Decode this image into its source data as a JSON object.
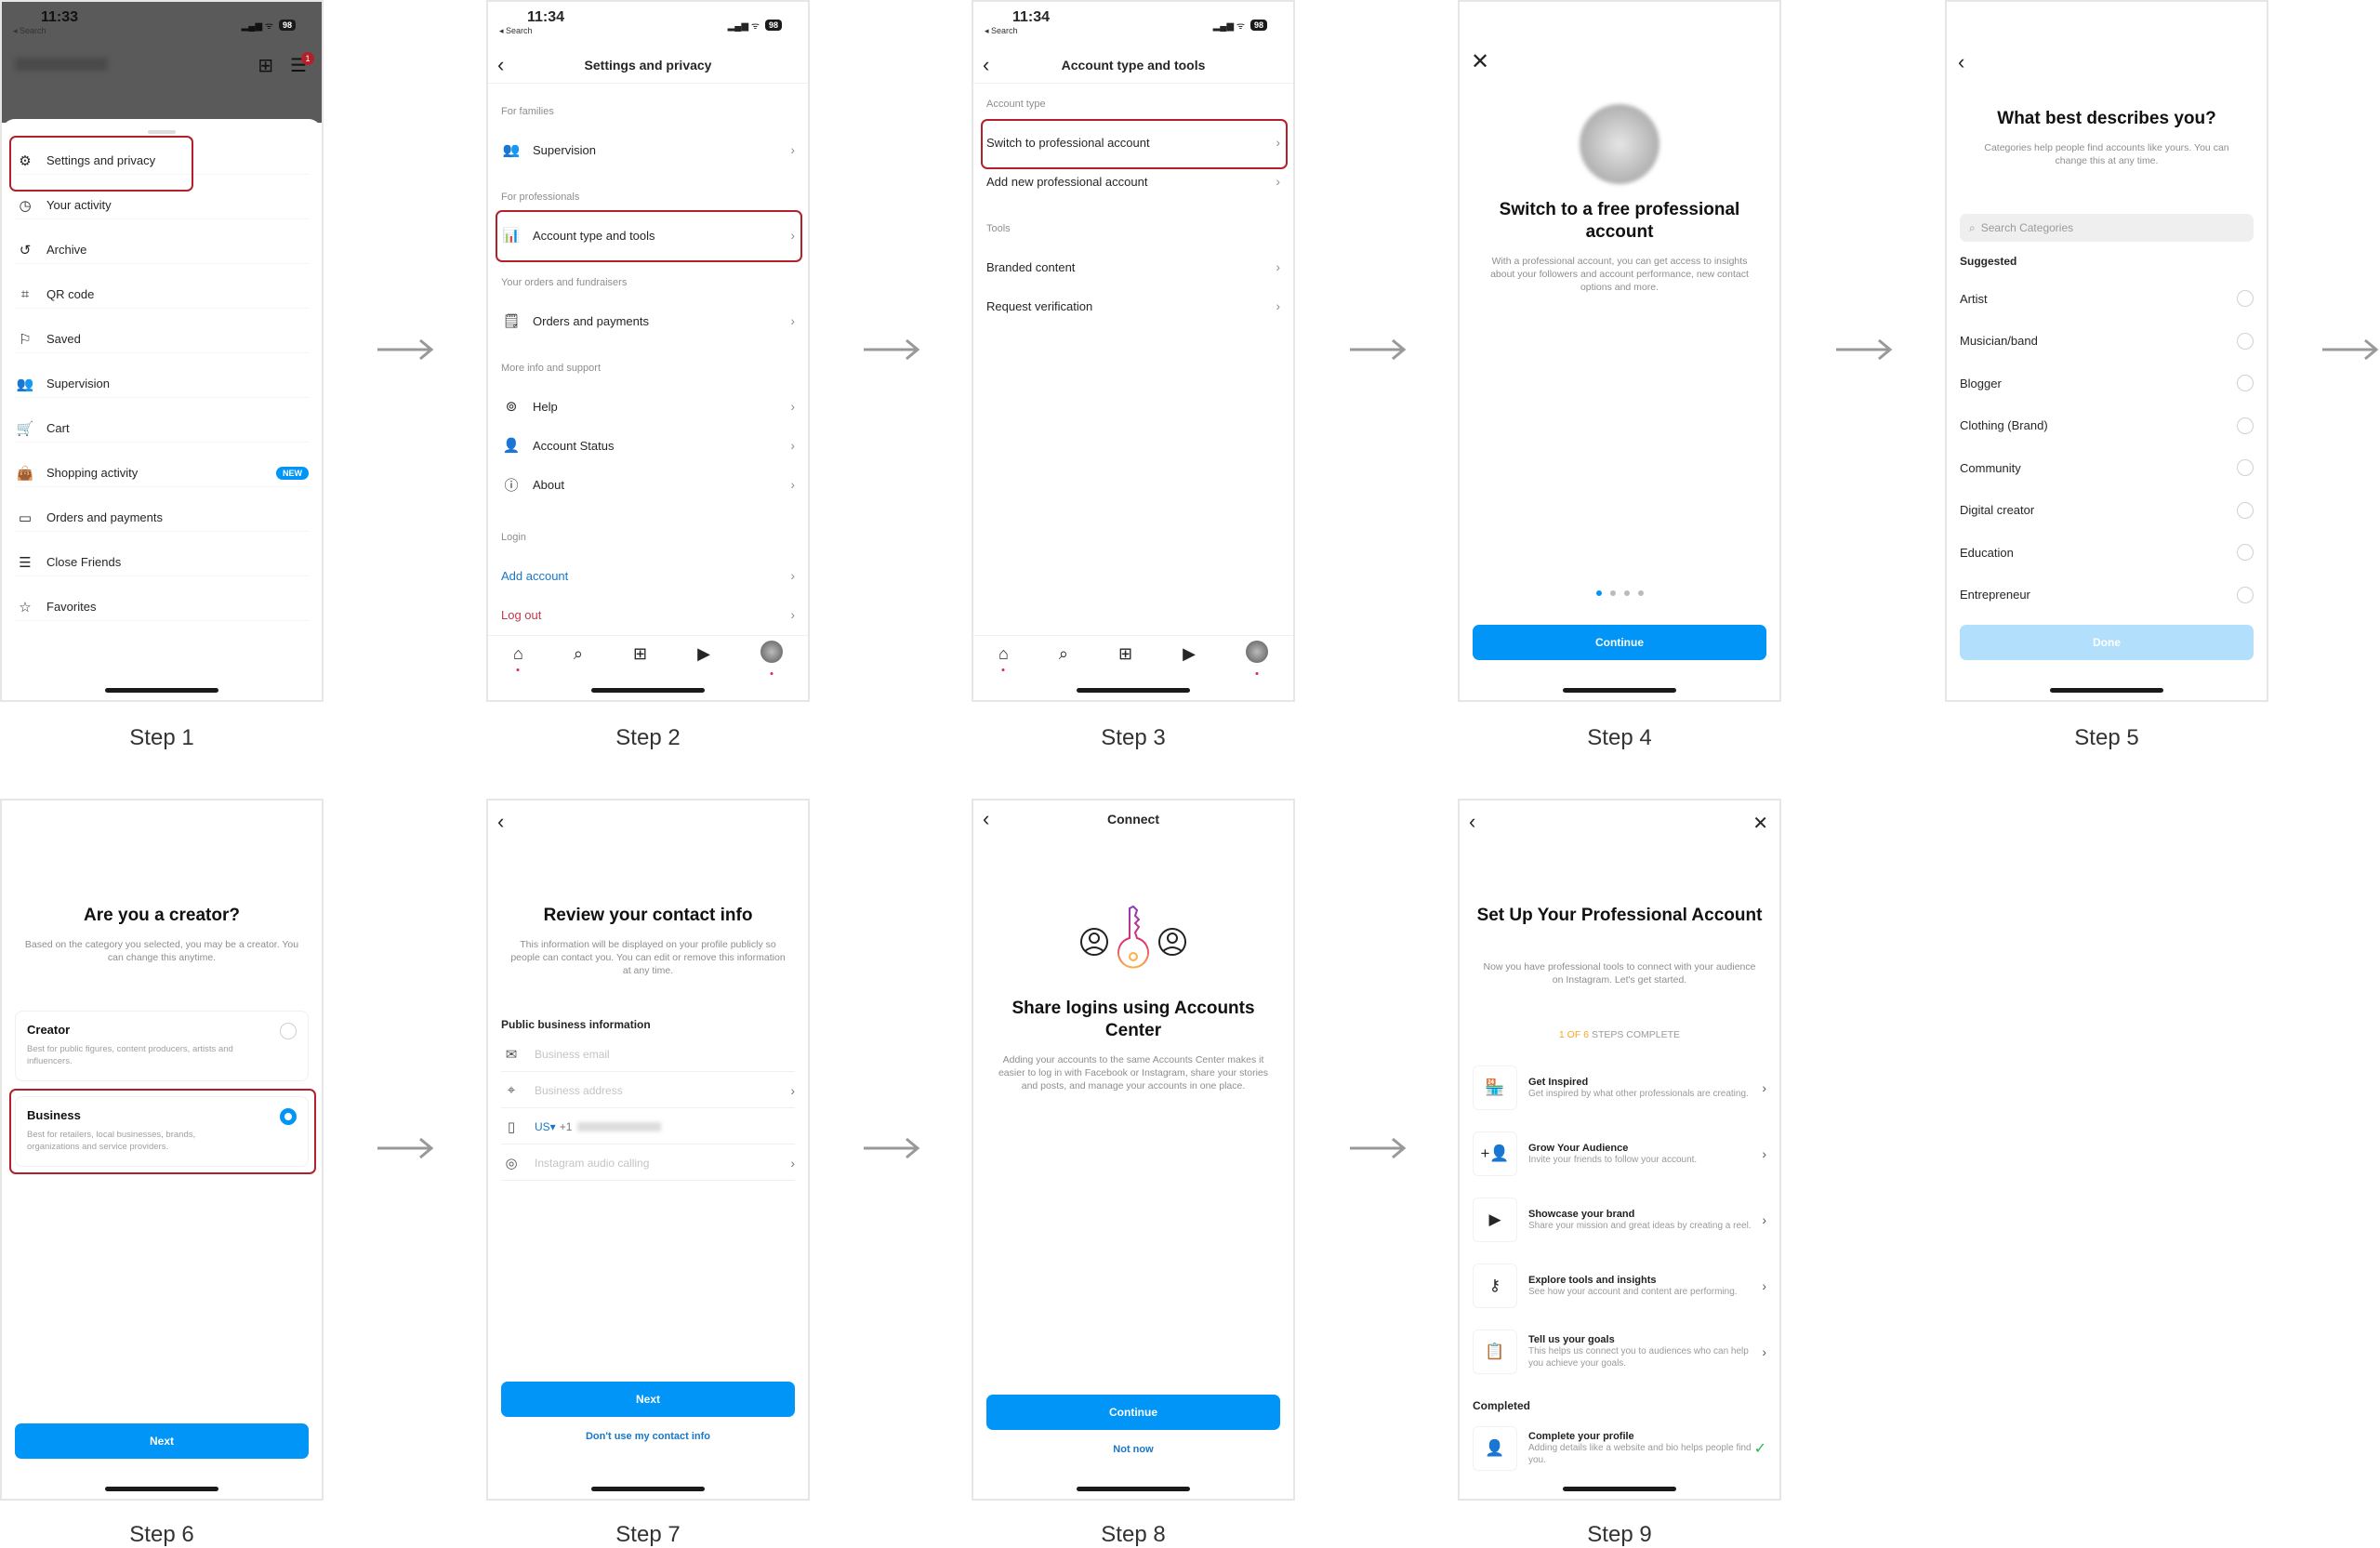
{
  "steps": [
    {
      "label": "Step 1"
    },
    {
      "label": "Step 2"
    },
    {
      "label": "Step 3"
    },
    {
      "label": "Step 4"
    },
    {
      "label": "Step 5"
    },
    {
      "label": "Step 6"
    },
    {
      "label": "Step 7"
    },
    {
      "label": "Step 8"
    },
    {
      "label": "Step 9"
    }
  ],
  "status": {
    "time_1": "11:33",
    "time_2": "11:34",
    "back": "◂ Search",
    "battery": "98"
  },
  "step1": {
    "notification_count": "1",
    "menu": [
      {
        "icon": "gear-icon",
        "glyph": "⚙",
        "label": "Settings and privacy"
      },
      {
        "icon": "activity-icon",
        "glyph": "◷",
        "label": "Your activity"
      },
      {
        "icon": "archive-icon",
        "glyph": "↺",
        "label": "Archive"
      },
      {
        "icon": "qr-code-icon",
        "glyph": "⌗",
        "label": "QR code"
      },
      {
        "icon": "bookmark-icon",
        "glyph": "⚐",
        "label": "Saved"
      },
      {
        "icon": "supervision-icon",
        "glyph": "👥",
        "label": "Supervision"
      },
      {
        "icon": "cart-icon",
        "glyph": "🛒",
        "label": "Cart"
      },
      {
        "icon": "shopping-bag-icon",
        "glyph": "👜",
        "label": "Shopping activity",
        "badge": "NEW"
      },
      {
        "icon": "card-icon",
        "glyph": "▭",
        "label": "Orders and payments"
      },
      {
        "icon": "list-icon",
        "glyph": "☰",
        "label": "Close Friends"
      },
      {
        "icon": "star-icon",
        "glyph": "☆",
        "label": "Favorites"
      }
    ]
  },
  "step2": {
    "title": "Settings and privacy",
    "sec_families": "For families",
    "supervision": "Supervision",
    "sec_professionals": "For professionals",
    "account_type_tools": "Account type and tools",
    "sec_orders": "Your orders and fundraisers",
    "orders_payments": "Orders and payments",
    "sec_more": "More info and support",
    "help": "Help",
    "account_status": "Account Status",
    "about": "About",
    "sec_login": "Login",
    "add_account": "Add account",
    "log_out": "Log out"
  },
  "step3": {
    "title": "Account type and tools",
    "sec_account_type": "Account type",
    "switch_pro": "Switch to professional account",
    "add_pro": "Add new professional account",
    "sec_tools": "Tools",
    "branded": "Branded content",
    "verification": "Request verification"
  },
  "step4": {
    "title": "Switch to a free professional account",
    "description": "With a professional account, you can get access to insights about your followers and account performance, new contact options and more.",
    "page_index": "1 of 4",
    "continue": "Continue"
  },
  "step5": {
    "title": "What best describes you?",
    "description": "Categories help people find accounts like yours. You can change this at any time.",
    "search_placeholder": "Search Categories",
    "suggested": "Suggested",
    "categories": [
      "Artist",
      "Musician/band",
      "Blogger",
      "Clothing (Brand)",
      "Community",
      "Digital creator",
      "Education",
      "Entrepreneur"
    ],
    "done": "Done"
  },
  "step6": {
    "title": "Are you a creator?",
    "description": "Based on the category you selected, you may be a creator. You can change this anytime.",
    "creator_title": "Creator",
    "creator_desc": "Best for public figures, content producers, artists and influencers.",
    "business_title": "Business",
    "business_desc": "Best for retailers, local businesses, brands, organizations and service providers.",
    "selected": "Business",
    "next": "Next"
  },
  "step7": {
    "title": "Review your contact info",
    "description": "This information will be displayed on your profile publicly so people can contact you. You can edit or remove this information at any time.",
    "section": "Public business information",
    "email_placeholder": "Business email",
    "address_placeholder": "Business address",
    "country": "US▾",
    "country_code": "+1",
    "audio_placeholder": "Instagram audio calling",
    "next": "Next",
    "skip": "Don't use my contact info"
  },
  "step8": {
    "header": "Connect",
    "title": "Share logins using Accounts Center",
    "description": "Adding your accounts to the same Accounts Center makes it easier to log in with Facebook or Instagram, share your stories and posts, and manage your accounts in one place.",
    "continue": "Continue",
    "not_now": "Not now"
  },
  "step9": {
    "title": "Set Up Your Professional Account",
    "description": "Now you have professional tools to connect with your audience on Instagram. Let's get started.",
    "progress_count": "1 OF 6",
    "progress_text": " STEPS COMPLETE",
    "progress_color": "#f5a623",
    "tasks": [
      {
        "icon": "store-icon",
        "glyph": "🏪",
        "title": "Get Inspired",
        "desc": "Get inspired by what other professionals are creating."
      },
      {
        "icon": "add-person-icon",
        "glyph": "+👤",
        "title": "Grow Your Audience",
        "desc": "Invite your friends to follow your account."
      },
      {
        "icon": "reel-icon",
        "glyph": "▶",
        "title": "Showcase your brand",
        "desc": "Share your mission and great ideas by creating a reel."
      },
      {
        "icon": "key-icon",
        "glyph": "⚷",
        "title": "Explore tools and insights",
        "desc": "See how your account and content are performing."
      },
      {
        "icon": "clipboard-icon",
        "glyph": "📋",
        "title": "Tell us your goals",
        "desc": "This helps us connect you to audiences who can help you achieve your goals."
      }
    ],
    "completed_label": "Completed",
    "completed": {
      "icon": "person-icon",
      "glyph": "👤",
      "title": "Complete your profile",
      "desc": "Adding details like a website and bio helps people find you."
    }
  },
  "colors": {
    "accent": "#0095f6",
    "highlight": "#b3202a",
    "link": "#1877c8",
    "logout": "#c0394b",
    "check": "#2db84d"
  }
}
